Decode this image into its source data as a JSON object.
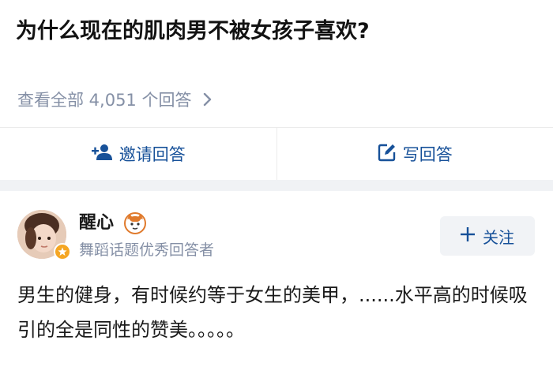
{
  "question": {
    "title": "为什么现在的肌肉男不被女孩子喜欢?",
    "view_all": "查看全部 4,051 个回答",
    "view_all_chevron": "chevron-right-icon"
  },
  "actions": {
    "invite": {
      "label": "邀请回答",
      "icon": "add-user-icon"
    },
    "write": {
      "label": "写回答",
      "icon": "edit-icon"
    }
  },
  "answer": {
    "author": {
      "name": "醒心",
      "bio": "舞蹈话题优秀回答者",
      "avatar": "avatar",
      "badge_icon": "star-badge-icon",
      "emoji_icon": "cat-emoji-icon"
    },
    "follow_label": "关注",
    "follow_icon": "plus-icon",
    "text": "男生的健身，有时候约等于女生的美甲，......水平高的时候吸引的全是同性的赞美。。。。。"
  },
  "colors": {
    "accent": "#175199",
    "muted": "#8590a6",
    "badge": "#f5a623",
    "band": "#f0f2f5"
  }
}
